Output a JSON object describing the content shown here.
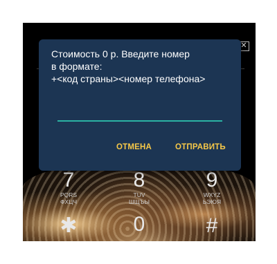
{
  "dialog": {
    "message_lines": [
      "Стоимость 0 р. Введите номер",
      "в формате:",
      "+<код страны><номер телефона>"
    ],
    "input_value": "",
    "cancel_label": "ОТМЕНА",
    "send_label": "ОТПРАВИТЬ"
  },
  "keypad": [
    {
      "digit": "7",
      "latin": "PQRS",
      "cyrillic": "ФХЦЧ"
    },
    {
      "digit": "8",
      "latin": "TUV",
      "cyrillic": "ШЩЪЫ"
    },
    {
      "digit": "9",
      "latin": "WXYZ",
      "cyrillic": "ЬЭЮЯ"
    },
    {
      "digit": "✱",
      "latin": "",
      "cyrillic": ""
    },
    {
      "digit": "0",
      "latin": "",
      "cyrillic": ""
    },
    {
      "digit": "#",
      "latin": "",
      "cyrillic": ""
    }
  ],
  "colors": {
    "dialog_bg": "#1c3553",
    "accent_button": "#f7c948",
    "input_underline": "#2bb3a3"
  }
}
